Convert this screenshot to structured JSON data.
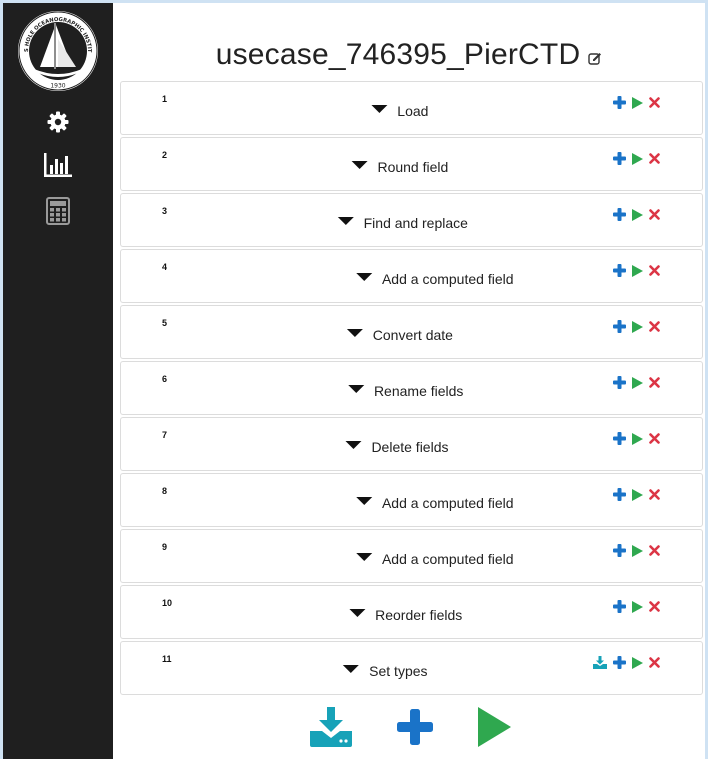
{
  "colors": {
    "sidebar": "#1f1f1f",
    "add": "#1a73c8",
    "run": "#2fa84f",
    "delete": "#dc3545",
    "download": "#17a2b8",
    "page_border": "#cfe2f3"
  },
  "logo": {
    "icon": "institution-seal-logo",
    "top_text": "WOODS HOLE OCEANOGRAPHIC INSTITUTION",
    "year": "1930"
  },
  "sidebar": {
    "items": [
      {
        "icon": "gear-icon"
      },
      {
        "icon": "bar-chart-icon"
      },
      {
        "icon": "calculator-icon"
      }
    ]
  },
  "workflow": {
    "title": "usecase_746395_PierCTD",
    "steps": [
      {
        "number": "1",
        "label": "Load"
      },
      {
        "number": "2",
        "label": "Round field"
      },
      {
        "number": "3",
        "label": "Find and replace"
      },
      {
        "number": "4",
        "label": "Add a computed field"
      },
      {
        "number": "5",
        "label": "Convert date"
      },
      {
        "number": "6",
        "label": "Rename fields"
      },
      {
        "number": "7",
        "label": "Delete fields"
      },
      {
        "number": "8",
        "label": "Add a computed field"
      },
      {
        "number": "9",
        "label": "Add a computed field"
      },
      {
        "number": "10",
        "label": "Reorder fields"
      },
      {
        "number": "11",
        "label": "Set types",
        "has_download": true
      }
    ]
  },
  "bottom_actions": [
    "download-icon",
    "add-icon",
    "run-icon"
  ]
}
